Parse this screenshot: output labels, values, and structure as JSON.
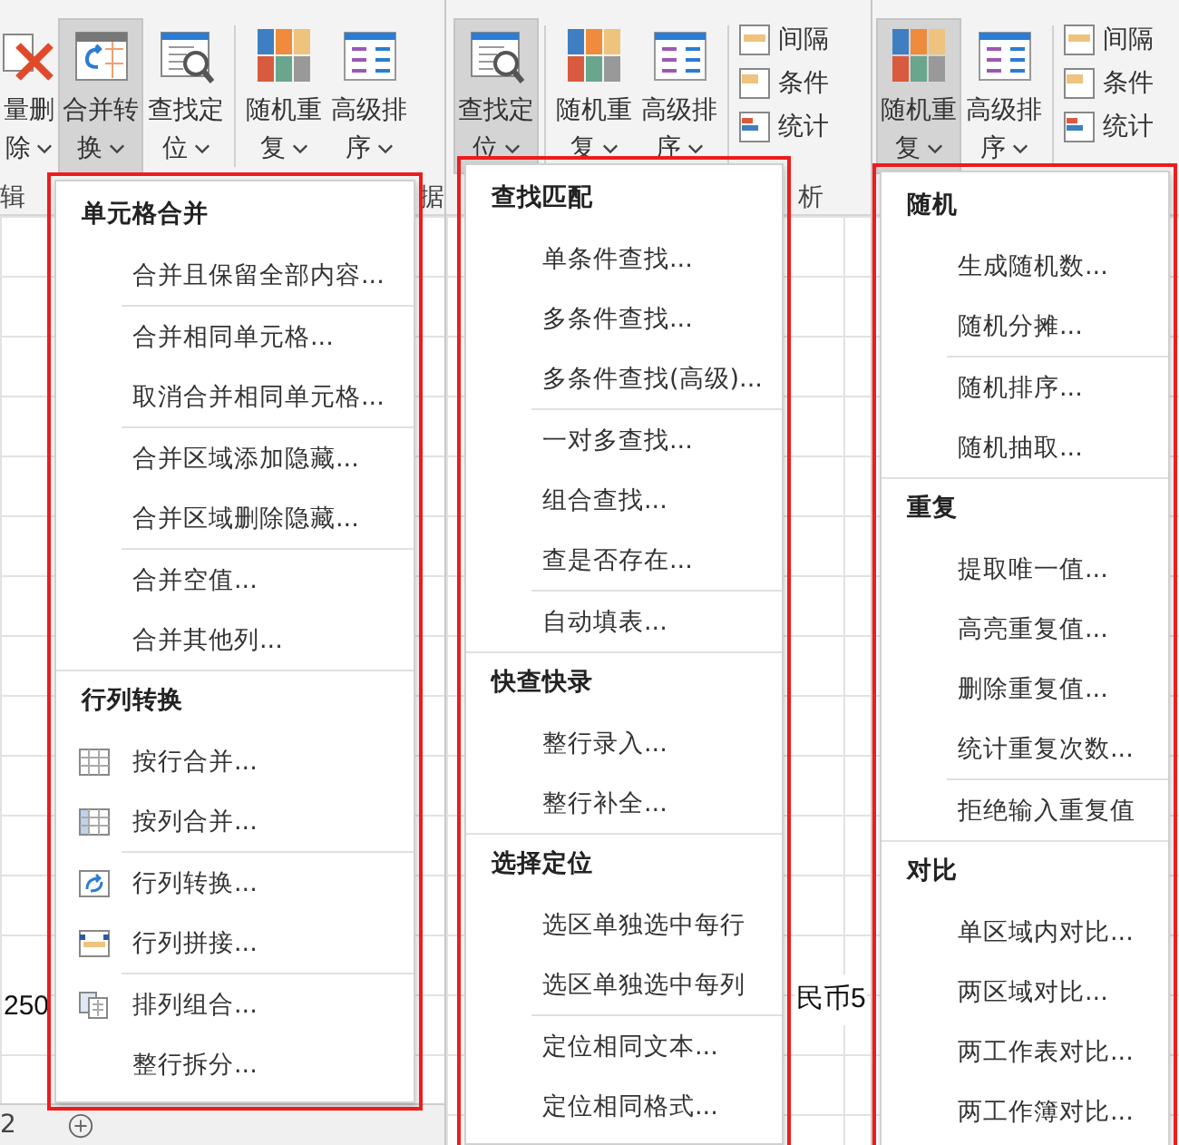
{
  "panels": [
    {
      "ribbon": {
        "buttons": [
          {
            "kind": "large",
            "label": "量删除",
            "pressed": false
          },
          {
            "kind": "large",
            "label": "合并转换",
            "pressed": true
          },
          {
            "kind": "large",
            "label": "查找定位",
            "pressed": false
          },
          {
            "kind": "separator"
          },
          {
            "kind": "large",
            "label": "随机重复",
            "pressed": false
          },
          {
            "kind": "large",
            "label": "高级排序",
            "pressed": false
          }
        ],
        "group_labels": [
          "辑",
          "据"
        ]
      },
      "sheet": {
        "fragments": [
          "250"
        ],
        "sheet_tab": "2"
      },
      "menu": {
        "sections": [
          {
            "title": "单元格合并",
            "groups": [
              [
                {
                  "label": "合并且保留全部内容..."
                }
              ],
              [
                {
                  "label": "合并相同单元格..."
                },
                {
                  "label": "取消合并相同单元格..."
                }
              ],
              [
                {
                  "label": "合并区域添加隐藏..."
                },
                {
                  "label": "合并区域删除隐藏..."
                }
              ],
              [
                {
                  "label": "合并空值..."
                },
                {
                  "label": "合并其他列..."
                }
              ]
            ]
          },
          {
            "title": "行列转换",
            "groups": [
              [
                {
                  "label": "按行合并..."
                },
                {
                  "label": "按列合并..."
                }
              ],
              [
                {
                  "label": "行列转换..."
                },
                {
                  "label": "行列拼接..."
                }
              ],
              [
                {
                  "label": "排列组合..."
                },
                {
                  "label": "整行拆分..."
                }
              ]
            ]
          }
        ]
      }
    },
    {
      "ribbon": {
        "buttons": [
          {
            "kind": "large",
            "label": "查找定位",
            "pressed": true
          },
          {
            "kind": "separator"
          },
          {
            "kind": "large",
            "label": "随机重复",
            "pressed": false
          },
          {
            "kind": "large",
            "label": "高级排序",
            "pressed": false
          },
          {
            "kind": "separator"
          },
          {
            "kind": "stack",
            "items": [
              {
                "label": "间隔"
              },
              {
                "label": "条件"
              },
              {
                "label": "统计"
              }
            ]
          }
        ],
        "group_labels": [
          "析"
        ]
      },
      "sheet": {
        "fragments": [
          "民币5"
        ]
      },
      "menu": {
        "sections": [
          {
            "title": "查找匹配",
            "groups": [
              [
                {
                  "label": "单条件查找..."
                },
                {
                  "label": "多条件查找..."
                },
                {
                  "label": "多条件查找(高级)..."
                }
              ],
              [
                {
                  "label": "一对多查找..."
                },
                {
                  "label": "组合查找..."
                },
                {
                  "label": "查是否存在..."
                }
              ],
              [
                {
                  "label": "自动填表..."
                }
              ]
            ]
          },
          {
            "title": "快查快录",
            "groups": [
              [
                {
                  "label": "整行录入..."
                },
                {
                  "label": "整行补全..."
                }
              ]
            ]
          },
          {
            "title": "选择定位",
            "groups": [
              [
                {
                  "label": "选区单独选中每行"
                },
                {
                  "label": "选区单独选中每列"
                }
              ],
              [
                {
                  "label": "定位相同文本..."
                },
                {
                  "label": "定位相同格式..."
                }
              ]
            ]
          }
        ]
      }
    },
    {
      "ribbon": {
        "buttons": [
          {
            "kind": "large",
            "label": "随机重复",
            "pressed": true
          },
          {
            "kind": "large",
            "label": "高级排序",
            "pressed": false
          },
          {
            "kind": "separator"
          },
          {
            "kind": "stack",
            "items": [
              {
                "label": "间隔"
              },
              {
                "label": "条件"
              },
              {
                "label": "统计"
              }
            ]
          }
        ]
      },
      "menu": {
        "sections": [
          {
            "title": "随机",
            "groups": [
              [
                {
                  "label": "生成随机数..."
                },
                {
                  "label": "随机分摊..."
                }
              ],
              [
                {
                  "label": "随机排序..."
                },
                {
                  "label": "随机抽取..."
                }
              ]
            ]
          },
          {
            "title": "重复",
            "groups": [
              [
                {
                  "label": "提取唯一值..."
                },
                {
                  "label": "高亮重复值..."
                },
                {
                  "label": "删除重复值..."
                },
                {
                  "label": "统计重复次数..."
                }
              ],
              [
                {
                  "label": "拒绝输入重复值"
                }
              ]
            ]
          },
          {
            "title": "对比",
            "groups": [
              [
                {
                  "label": "单区域内对比..."
                },
                {
                  "label": "两区域对比..."
                },
                {
                  "label": "两工作表对比..."
                },
                {
                  "label": "两工作簿对比..."
                }
              ]
            ]
          }
        ]
      }
    }
  ]
}
